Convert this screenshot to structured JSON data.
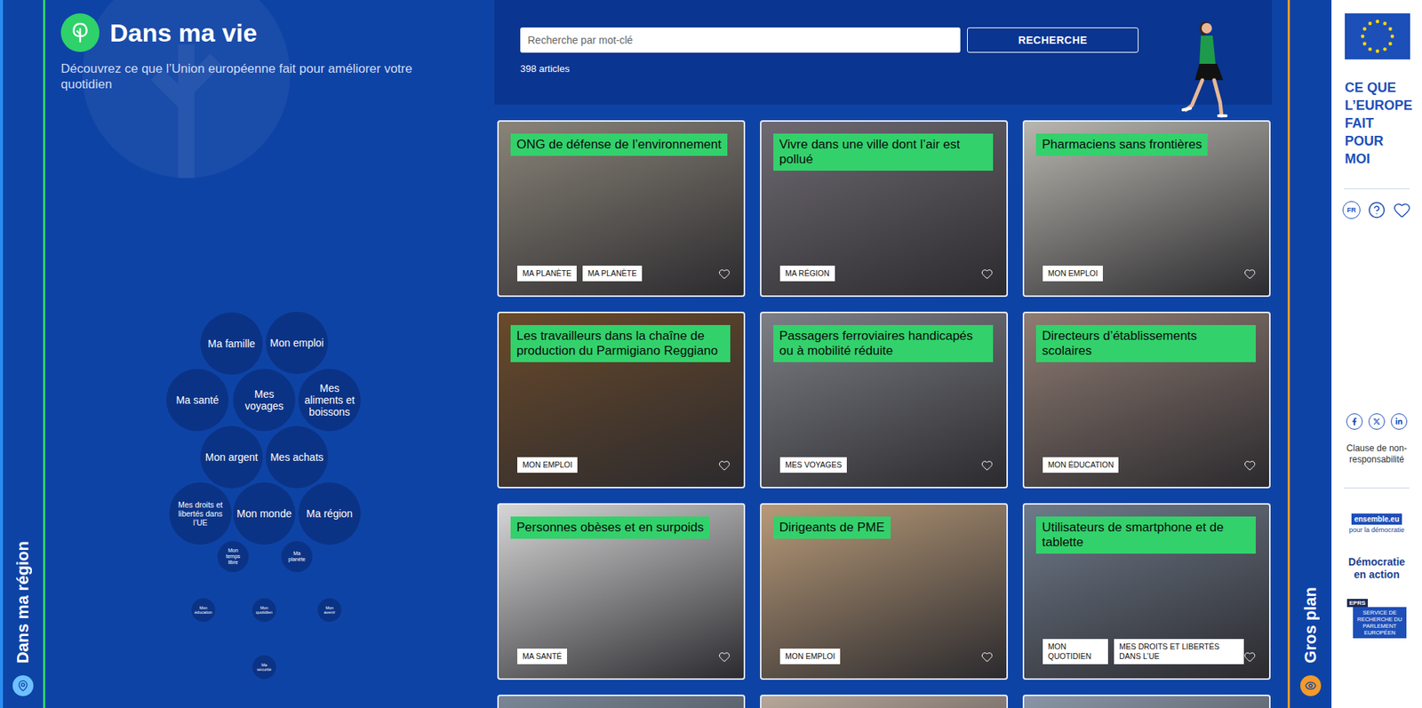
{
  "left_strip": {
    "label": "Dans ma région"
  },
  "header": {
    "title": "Dans ma vie",
    "subtitle": "Découvrez ce que l’Union européenne fait pour améliorer votre quotidien"
  },
  "topics": [
    {
      "label": "Ma famille"
    },
    {
      "label": "Mon emploi"
    },
    {
      "label": "Ma santé"
    },
    {
      "label": "Mes voyages"
    },
    {
      "label": "Mes aliments et boissons"
    },
    {
      "label": "Mon argent"
    },
    {
      "label": "Mes achats"
    },
    {
      "label": "Mes droits et libertés dans l’UE"
    },
    {
      "label": "Mon monde"
    },
    {
      "label": "Ma région"
    },
    {
      "label": "Mon temps libre"
    },
    {
      "label": "Ma planète"
    },
    {
      "label": "Mon éducation"
    },
    {
      "label": "Mon quotidien"
    },
    {
      "label": "Mon avenir"
    },
    {
      "label": "Ma sécurité"
    }
  ],
  "search": {
    "placeholder": "Recherche par mot-clé",
    "button": "RECHERCHE",
    "count": "398 articles"
  },
  "cards": [
    {
      "kind": "full",
      "title": "ONG de défense de l’environnement",
      "tags": [
        "MA PLANÈTE",
        "MA PLANÈTE"
      ],
      "favorite": false
    },
    {
      "kind": "full",
      "title": "Vivre dans une ville dont l’air est pollué",
      "tags": [
        "MA RÉGION"
      ],
      "favorite": false
    },
    {
      "kind": "full",
      "title": "Pharmaciens sans frontières",
      "tags": [
        "MON EMPLOI"
      ],
      "favorite": false
    },
    {
      "kind": "full",
      "title": "Les travailleurs dans la chaîne de production du Parmigiano Reggiano",
      "tags": [
        "MON EMPLOI"
      ],
      "favorite": false
    },
    {
      "kind": "full",
      "title": "Passagers ferroviaires handicapés ou à mobilité réduite",
      "tags": [
        "MES VOYAGES"
      ],
      "favorite": false
    },
    {
      "kind": "full",
      "title": "Directeurs d’établissements scolaires",
      "tags": [
        "MON ÉDUCATION"
      ],
      "favorite": false
    },
    {
      "kind": "full",
      "title": "Personnes obèses et en surpoids",
      "tags": [
        "MA SANTÉ"
      ],
      "favorite": false
    },
    {
      "kind": "full",
      "title": "Dirigeants de PME",
      "tags": [
        "MON EMPLOI"
      ],
      "favorite": false
    },
    {
      "kind": "full",
      "title": "Utilisateurs de smartphone et de tablette",
      "tags": [
        "MON QUOTIDIEN",
        "MES DROITS ET LIBERTÉS DANS L’UE"
      ],
      "favorite": false
    },
    {
      "kind": "cut"
    },
    {
      "kind": "cut"
    },
    {
      "kind": "cut"
    }
  ],
  "right_strip": {
    "label": "Gros plan"
  },
  "sidebar": {
    "brand_lines": [
      "CE QUE",
      "L’EUROPE",
      "FAIT",
      "POUR",
      "MOI"
    ],
    "language": "FR",
    "favorite": false,
    "disclaimer": "Clause de non-responsabilité",
    "ensemble": {
      "name": "ensemble.eu",
      "tagline": "pour la démocratie"
    },
    "democratie": "Démocratie en action",
    "eprs": {
      "acronym": "EPRS",
      "name": "SERVICE DE RECHERCHE DU PARLEMENT EUROPÉEN"
    }
  }
}
